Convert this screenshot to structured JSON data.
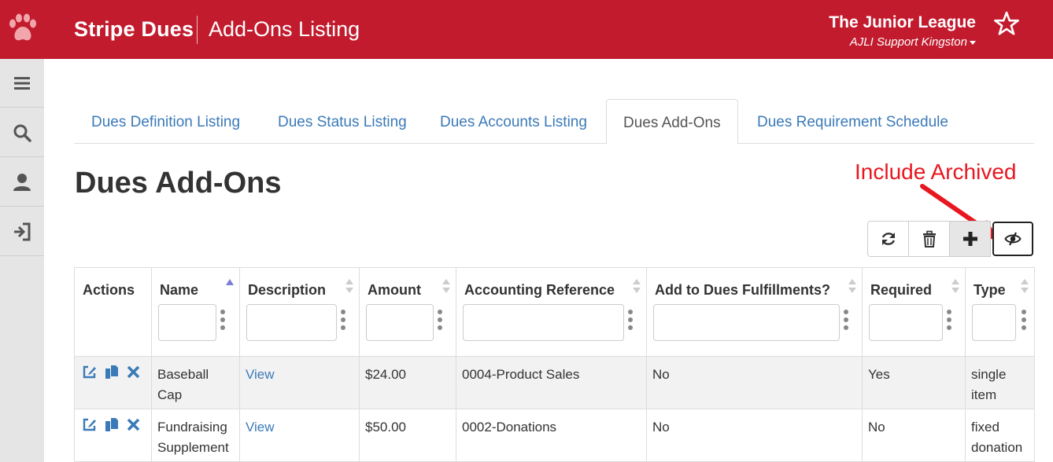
{
  "header": {
    "brand": "Stripe Dues",
    "page_title": "Add-Ons Listing",
    "org_name": "The Junior League",
    "org_sub": "AJLI Support Kingston",
    "icons": [
      "paw-logo-icon",
      "star-icon"
    ],
    "brand_color": "#c21b2e"
  },
  "sidebar": {
    "items": [
      {
        "icon": "menu-icon"
      },
      {
        "icon": "search-icon"
      },
      {
        "icon": "user-icon"
      },
      {
        "icon": "logout-icon"
      }
    ]
  },
  "tabs": [
    {
      "label": "Dues Definition Listing",
      "active": false
    },
    {
      "label": "Dues Status Listing",
      "active": false
    },
    {
      "label": "Dues Accounts Listing",
      "active": false
    },
    {
      "label": "Dues Add-Ons",
      "active": true
    },
    {
      "label": "Dues Requirement Schedule",
      "active": false
    }
  ],
  "main": {
    "heading": "Dues Add-Ons",
    "annotation": "Include Archived",
    "toolbar": [
      "refresh-icon",
      "trash-icon",
      "plus-icon",
      "eye-slash-icon"
    ]
  },
  "table": {
    "columns": [
      "Actions",
      "Name",
      "Description",
      "Amount",
      "Accounting Reference",
      "Add to Dues Fulfillments?",
      "Required",
      "Type"
    ],
    "rows": [
      {
        "name": "Baseball Cap",
        "description": "View",
        "amount": "$24.00",
        "accounting_reference": "0004-Product Sales",
        "add_to_fulfillments": "No",
        "required": "Yes",
        "type": "single item"
      },
      {
        "name": "Fundraising Supplement",
        "description": "View",
        "amount": "$50.00",
        "accounting_reference": "0002-Donations",
        "add_to_fulfillments": "No",
        "required": "No",
        "type": "fixed donation"
      }
    ]
  },
  "colors": {
    "link": "#3b7ab8",
    "annotation": "#e8171f"
  }
}
